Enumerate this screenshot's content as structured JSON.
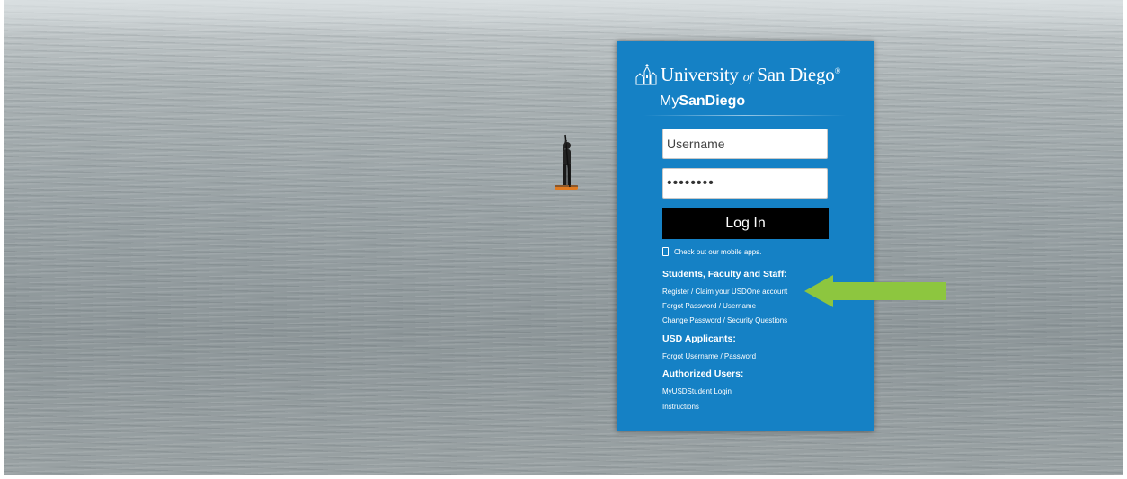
{
  "brand": {
    "university_part1": "University",
    "university_of": "of",
    "university_part2": "San Diego",
    "registered": "®",
    "app_prefix": "My",
    "app_name": "SanDiego"
  },
  "login": {
    "username_placeholder": "Username",
    "password_value": "••••••••",
    "button_label": "Log In"
  },
  "mobile": {
    "text": "Check out our mobile apps.",
    "icon": "phone-icon"
  },
  "sections": {
    "students": {
      "heading": "Students, Faculty and Staff:",
      "links": [
        "Register / Claim your USDOne account",
        "Forgot Password / Username",
        "Change Password / Security Questions"
      ]
    },
    "applicants": {
      "heading": "USD Applicants:",
      "links": [
        "Forgot Username / Password"
      ]
    },
    "authorized": {
      "heading": "Authorized Users:",
      "links": [
        "MyUSDStudent Login",
        "Instructions"
      ]
    }
  },
  "colors": {
    "panel": "#1581c5",
    "button": "#000000",
    "arrow": "#8dc63f"
  }
}
